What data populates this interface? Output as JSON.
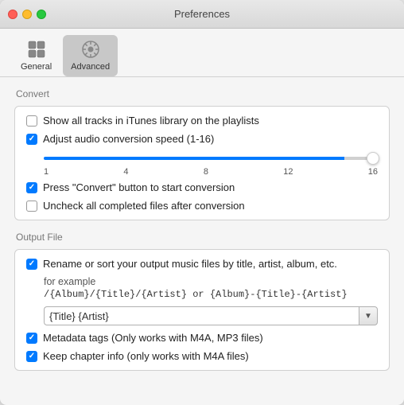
{
  "window": {
    "title": "Preferences"
  },
  "toolbar": {
    "items": [
      {
        "id": "general",
        "label": "General",
        "active": false
      },
      {
        "id": "advanced",
        "label": "Advanced",
        "active": true
      }
    ]
  },
  "convert_section": {
    "label": "Convert",
    "items": [
      {
        "id": "show-tracks",
        "checked": false,
        "label": "Show all tracks in iTunes library on the playlists"
      },
      {
        "id": "adjust-speed",
        "checked": true,
        "label": "Adjust audio conversion speed (1-16)"
      },
      {
        "id": "press-convert",
        "checked": true,
        "label": "Press \"Convert\" button to start conversion"
      },
      {
        "id": "uncheck-completed",
        "checked": false,
        "label": "Uncheck all completed files after conversion"
      }
    ],
    "slider": {
      "labels": [
        "1",
        "4",
        "8",
        "12",
        "16"
      ],
      "value": 90
    }
  },
  "output_section": {
    "label": "Output File",
    "items": [
      {
        "id": "rename-sort",
        "checked": true,
        "label": "Rename or sort your output music files by title, artist, album, etc."
      },
      {
        "id": "metadata-tags",
        "checked": true,
        "label": "Metadata tags (Only works with M4A, MP3 files)"
      },
      {
        "id": "keep-chapter",
        "checked": true,
        "label": "Keep chapter info (only works with  M4A files)"
      }
    ],
    "for_example_label": "for example",
    "example_code": "/{Album}/{Title}/{Artist} or {Album}-{Title}-{Artist}",
    "input_value": "{Title} {Artist}",
    "input_placeholder": "{Title} {Artist}",
    "dropdown_arrow": "▼"
  }
}
